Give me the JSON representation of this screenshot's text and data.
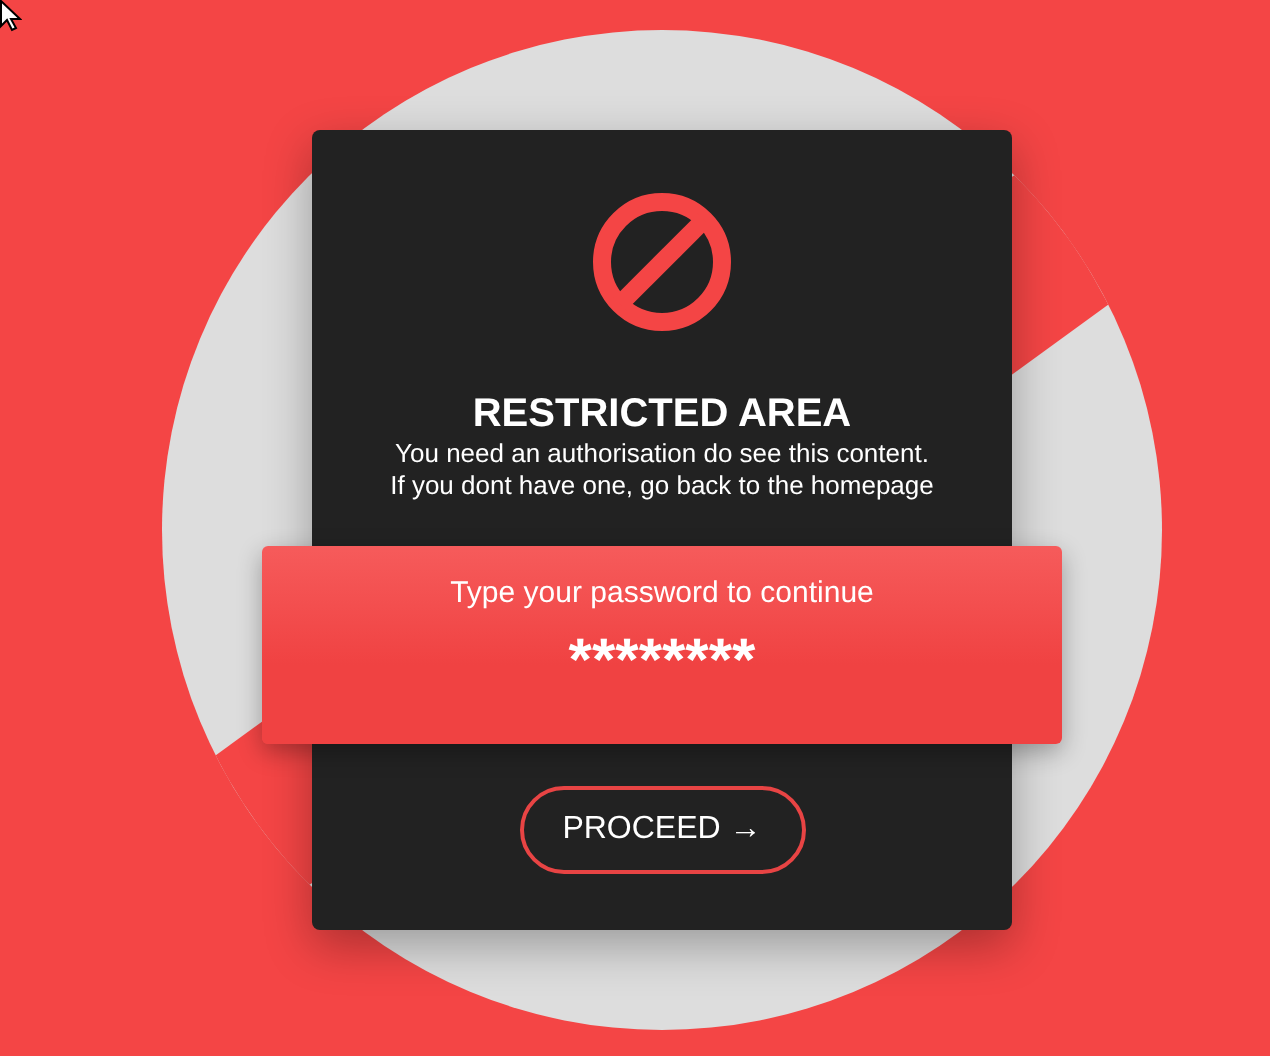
{
  "card": {
    "title": "RESTRICTED AREA",
    "message_lines": [
      "You need an authorisation do see this content.",
      "If you dont have one, go back to the homepage"
    ]
  },
  "password": {
    "label": "Type your password to continue",
    "value": "********"
  },
  "button": {
    "label": "PROCEED →"
  }
}
